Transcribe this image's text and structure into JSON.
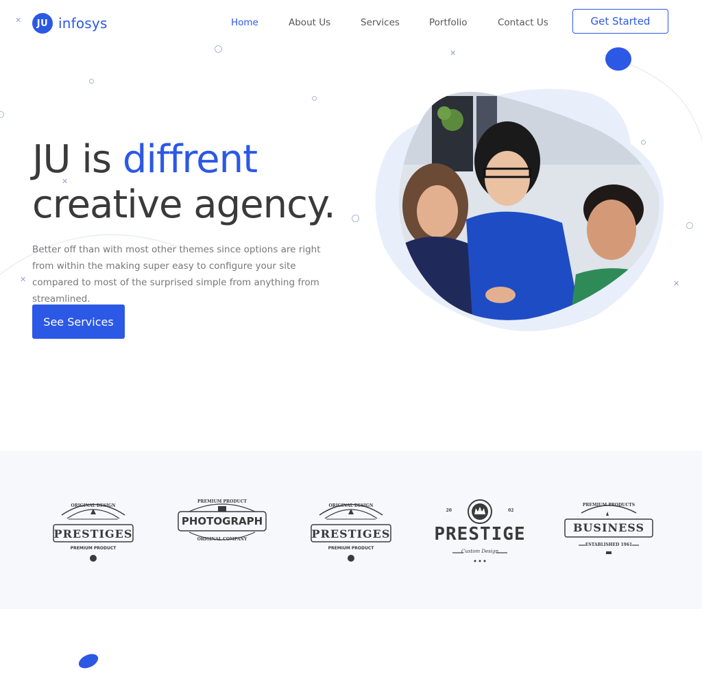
{
  "header": {
    "logo_badge": "JU",
    "logo_text": "infosys",
    "nav": [
      "Home",
      "About Us",
      "Services",
      "Portfolio",
      "Contact Us"
    ],
    "cta": "Get Started"
  },
  "hero": {
    "title_part1": "JU is ",
    "title_accent": "diffrent",
    "title_line2": "creative agency.",
    "description": "Better off than with most other themes since options are right from within the making super easy to configure your site compared to most of the surprised simple from anything from streamlined.",
    "button": "See Services"
  },
  "logos": [
    {
      "top": "ORIGINAL DESIGN",
      "main": "PRESTIGES",
      "sub": "PREMIUM PRODUCT"
    },
    {
      "top": "PREMIUM PRODUCT",
      "main": "PHOTOGRAPH",
      "sub": "ORIGINAL COMPANY"
    },
    {
      "top": "ORIGINAL DESIGN",
      "main": "PRESTIGES",
      "sub": "PREMIUM PRODUCT"
    },
    {
      "top": "20 · 02",
      "main": "PRESTIGE",
      "sub": "Custom Design"
    },
    {
      "top": "PREMIUM PRODUCTS",
      "main": "BUSINESS",
      "sub": "ESTABLISHED 1961"
    }
  ],
  "colors": {
    "accent": "#2c58e6",
    "band": "#f6f8fc"
  }
}
